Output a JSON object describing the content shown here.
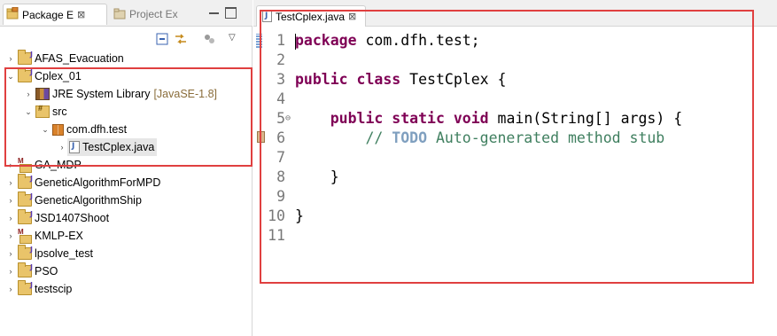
{
  "left_panel": {
    "tab_active": "Package E",
    "tab_inactive": "Project Ex",
    "tree": [
      {
        "label": "AFAS_Evacuation",
        "level": 0,
        "expanded": false,
        "icon": "project-folder-icon"
      },
      {
        "label": "Cplex_01",
        "level": 0,
        "expanded": true,
        "icon": "java-project-icon"
      },
      {
        "label": "JRE System Library",
        "decoration": "[JavaSE-1.8]",
        "level": 1,
        "expanded": false,
        "icon": "library-icon"
      },
      {
        "label": "src",
        "level": 1,
        "expanded": true,
        "icon": "source-folder-icon"
      },
      {
        "label": "com.dfh.test",
        "level": 2,
        "expanded": true,
        "icon": "package-icon"
      },
      {
        "label": "TestCplex.java",
        "level": 3,
        "expanded": false,
        "icon": "java-file-icon",
        "selected": true
      },
      {
        "label": "GA_MDP",
        "level": 0,
        "expanded": false,
        "icon": "maven-project-icon"
      },
      {
        "label": "GeneticAlgorithmForMPD",
        "level": 0,
        "expanded": false,
        "icon": "java-project-icon"
      },
      {
        "label": "GeneticAlgorithmShip",
        "level": 0,
        "expanded": false,
        "icon": "java-project-icon"
      },
      {
        "label": "JSD1407Shoot",
        "level": 0,
        "expanded": false,
        "icon": "java-project-icon"
      },
      {
        "label": "KMLP-EX",
        "level": 0,
        "expanded": false,
        "icon": "maven-project-icon"
      },
      {
        "label": "lpsolve_test",
        "level": 0,
        "expanded": false,
        "icon": "java-project-icon"
      },
      {
        "label": "PSO",
        "level": 0,
        "expanded": false,
        "icon": "java-project-icon"
      },
      {
        "label": "testscip",
        "level": 0,
        "expanded": false,
        "icon": "java-project-icon"
      }
    ]
  },
  "editor": {
    "tab_label": "TestCplex.java",
    "line_numbers": [
      "1",
      "2",
      "3",
      "4",
      "5",
      "6",
      "7",
      "8",
      "9",
      "10",
      "11"
    ],
    "lines": [
      [
        {
          "t": "package",
          "c": "kw"
        },
        {
          "t": " com.dfh.test;",
          "c": ""
        }
      ],
      [],
      [
        {
          "t": "public",
          "c": "kw"
        },
        {
          "t": " ",
          "c": ""
        },
        {
          "t": "class",
          "c": "kw"
        },
        {
          "t": " TestCplex {",
          "c": ""
        }
      ],
      [],
      [
        {
          "t": "    ",
          "c": ""
        },
        {
          "t": "public",
          "c": "kw"
        },
        {
          "t": " ",
          "c": ""
        },
        {
          "t": "static",
          "c": "kw"
        },
        {
          "t": " ",
          "c": ""
        },
        {
          "t": "void",
          "c": "kw"
        },
        {
          "t": " main(String[] args) {",
          "c": ""
        }
      ],
      [
        {
          "t": "        // ",
          "c": "cm"
        },
        {
          "t": "TODO",
          "c": "todo"
        },
        {
          "t": " Auto-generated method stub",
          "c": "cm"
        }
      ],
      [],
      [
        {
          "t": "    }",
          "c": ""
        }
      ],
      [],
      [
        {
          "t": "}",
          "c": ""
        }
      ],
      []
    ]
  },
  "colors": {
    "keyword": "#7f0055",
    "comment": "#3f7f5f",
    "todo": "#7f9fbf",
    "highlight_box": "#e04040"
  }
}
